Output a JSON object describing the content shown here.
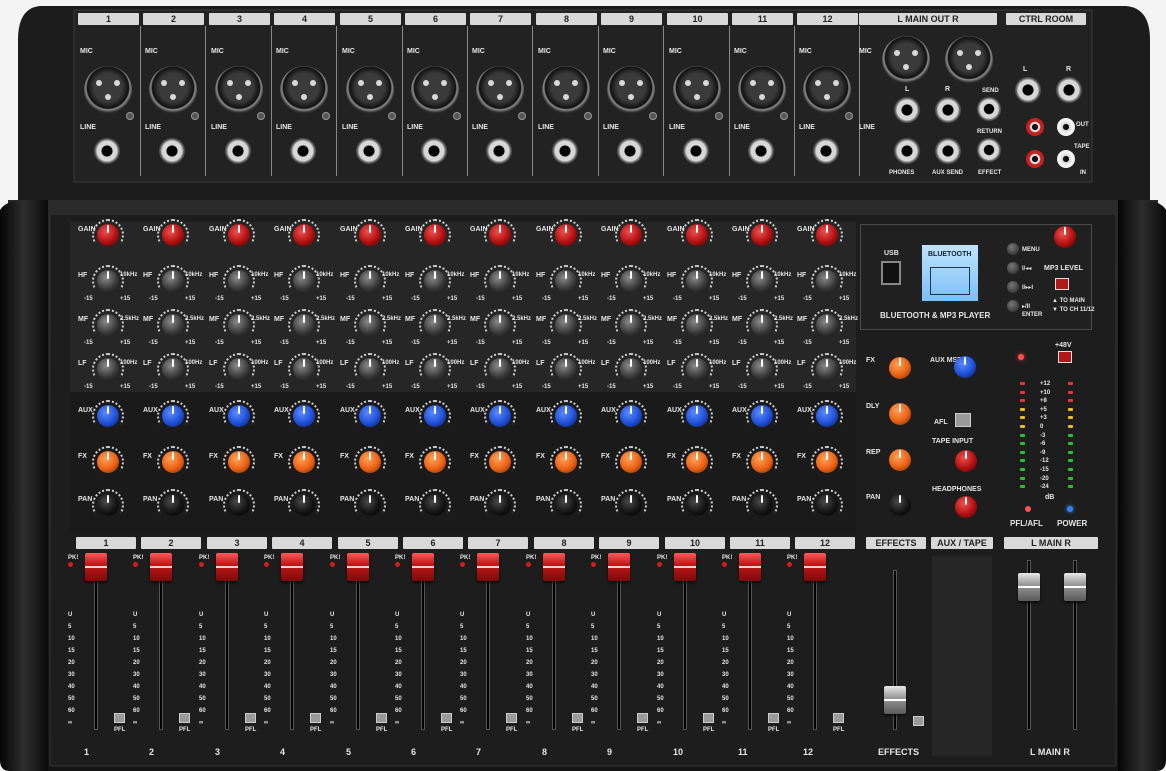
{
  "top_panel": {
    "channel_numbers": [
      "1",
      "2",
      "3",
      "4",
      "5",
      "6",
      "7",
      "8",
      "9",
      "10",
      "11",
      "12"
    ],
    "main_out_title": "L  MAIN OUT  R",
    "ctrl_room_title": "CTRL ROOM",
    "mic_label": "MIC",
    "line_label": "LINE",
    "main_mic_label": "MIC",
    "main_line_label": "LINE",
    "phones_label": "PHONES",
    "aux_send_label": "AUX SEND",
    "effect_label": "EFFECT",
    "send_label": "SEND",
    "return_label": "RETURN",
    "l_label": "L",
    "r_label": "R",
    "out_label": "OUT",
    "tape_label": "TAPE",
    "in_label": "IN"
  },
  "channel_strip": {
    "gain": "GAIN",
    "hf": "HF",
    "mf": "MF",
    "lf": "LF",
    "aux": "AUX",
    "fx": "FX",
    "pan": "PAN",
    "hf_freq": "10kHz",
    "mf_freq": "2.5kHz",
    "lf_freq": "100Hz",
    "eq_min": "-15",
    "eq_max": "+15",
    "pk": "PK!",
    "pfl": "PFL",
    "fader_scale": [
      "U",
      "5",
      "10",
      "15",
      "20",
      "30",
      "40",
      "50",
      "60",
      "∞"
    ]
  },
  "bluetooth": {
    "usb": "USB",
    "lcd_text": "BLUETOOTH",
    "title": "BLUETOOTH & MP3 PLAYER",
    "menu": "MENU",
    "prev": "I/◂◂",
    "next": "I/▸▸I",
    "play": "▸/II",
    "enter": "ENTER",
    "mp3_level": "MP3 LEVEL",
    "to_main": "▲ TO MAIN",
    "to_ch": "▼ TO CH 11/12"
  },
  "effects": {
    "fx": "FX",
    "dly": "DLY",
    "rep": "REP",
    "pan": "PAN",
    "title": "EFFECTS",
    "fader_label": "EFFECTS"
  },
  "aux_tape": {
    "aux_mst": "AUX MST",
    "afl": "AFL",
    "tape_input": "TAPE INPUT",
    "headphones": "HEADPHONES",
    "title": "AUX / TAPE"
  },
  "master": {
    "phantom": "+48V",
    "meter_scale": [
      "+12",
      "+10",
      "+8",
      "+5",
      "+3",
      "0",
      "-3",
      "-6",
      "-9",
      "-12",
      "-15",
      "-20",
      "-24"
    ],
    "meter_unit": "dB",
    "pfl_afl": "PFL/AFL",
    "power": "POWER",
    "title": "L  MAIN  R",
    "fader_label": "L  MAIN  R"
  },
  "colors": {
    "gain_knob": "#c81818",
    "aux_knob": "#1f4fd6",
    "fx_knob": "#ea6014",
    "fader_cap": "#c21818",
    "power_led": "#3a7bff"
  }
}
